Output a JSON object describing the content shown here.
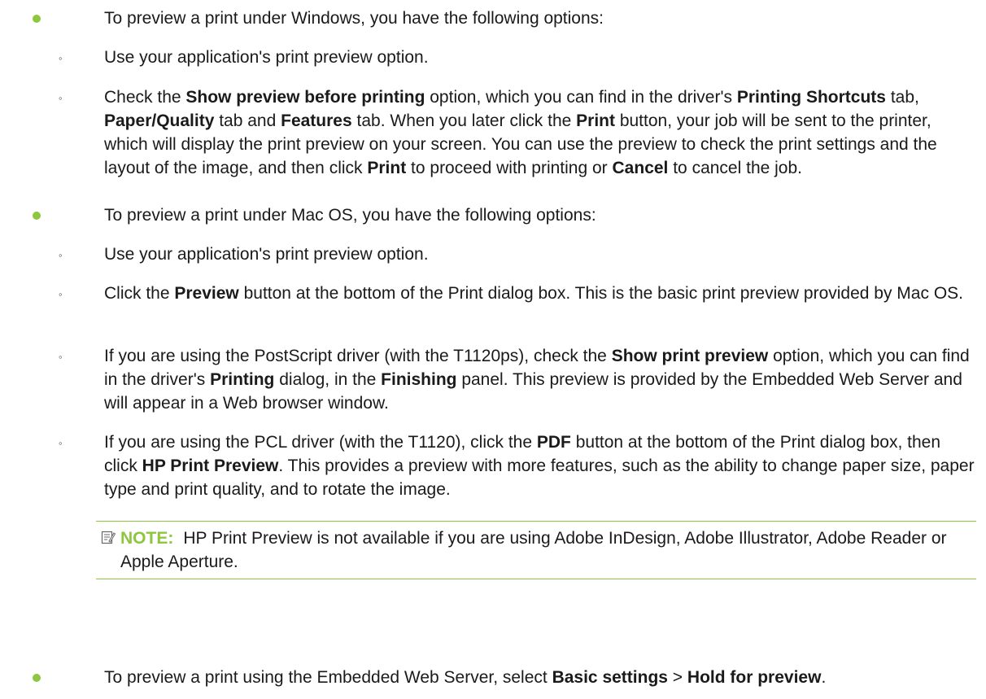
{
  "section1": {
    "intro": "To preview a print under Windows, you have the following options:",
    "item1": "Use your application's print preview option.",
    "item2": {
      "t1": "Check the ",
      "b1": "Show preview before printing",
      "t2": " option, which you can find in the driver's ",
      "b2": "Printing Shortcuts",
      "t3": " tab, ",
      "b3": "Paper/Quality",
      "t4": " tab and ",
      "b4": "Features",
      "t5": " tab. When you later click the ",
      "b5": "Print",
      "t6": " button, your job will be sent to the printer, which will display the print preview on your screen. You can use the preview to check the print settings and the layout of the image, and then click ",
      "b6": "Print",
      "t7": " to proceed with printing or ",
      "b7": "Cancel",
      "t8": " to cancel the job."
    }
  },
  "section2": {
    "intro": "To preview a print under Mac OS, you have the following options:",
    "item1": "Use your application's print preview option.",
    "item2": {
      "t1": "Click the ",
      "b1": "Preview",
      "t2": " button at the bottom of the Print dialog box. This is the basic print preview provided by Mac OS."
    },
    "item3": {
      "t1": "If you are using the PostScript driver (with the T1120ps), check the ",
      "b1": "Show print preview",
      "t2": " option, which you can find in the driver's ",
      "b2": "Printing",
      "t3": " dialog, in the ",
      "b3": "Finishing",
      "t4": " panel. This preview is provided by the Embedded Web Server and will appear in a Web browser window."
    },
    "item4": {
      "t1": "If you are using the PCL driver (with the T1120), click the ",
      "b1": "PDF",
      "t2": " button at the bottom of the Print dialog box, then click ",
      "b2": "HP Print Preview",
      "t3": ". This provides a preview with more features, such as the ability to change paper size, paper type and print quality, and to rotate the image."
    },
    "note": {
      "label": "NOTE:",
      "text": "HP Print Preview is not available if you are using Adobe InDesign, Adobe Illustrator, Adobe Reader or Apple Aperture."
    }
  },
  "section3": {
    "t1": "To preview a print using the Embedded Web Server, select ",
    "b1": "Basic settings",
    "t2": " > ",
    "b2": "Hold for preview",
    "t3": "."
  },
  "colors": {
    "accent": "#8dc63f",
    "text": "#1a1a1a"
  },
  "icons": {
    "bullet_level1": "green-dot",
    "bullet_level2": "small-circle",
    "note": "note-pencil-icon"
  }
}
